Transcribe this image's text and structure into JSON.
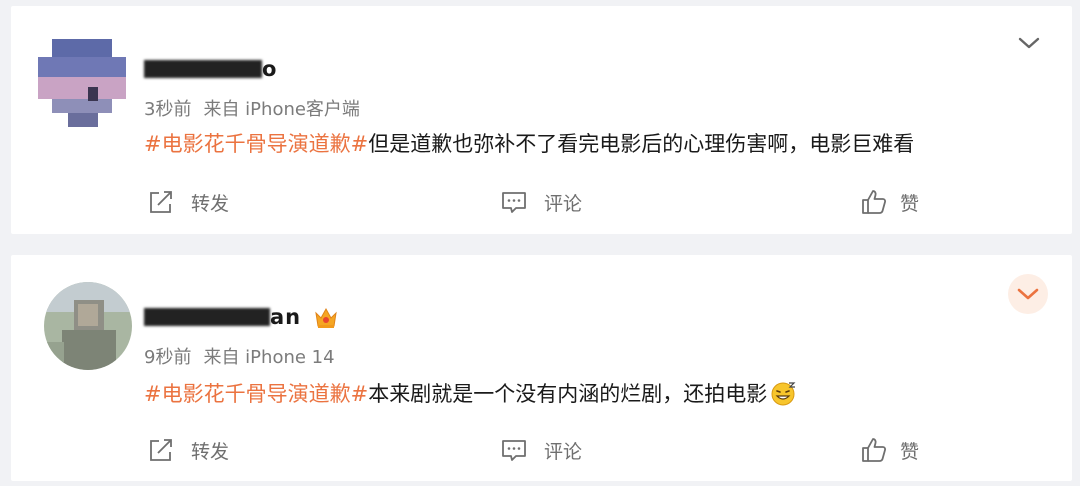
{
  "posts": [
    {
      "user": {
        "name_visible": "o"
      },
      "meta": {
        "time": "3秒前",
        "source": "来自 iPhone客户端"
      },
      "content": {
        "tag": "#电影花千骨导演道歉#",
        "text": "但是道歉也弥补不了看完电影后的心理伤害啊，电影巨难看"
      },
      "actions": {
        "repost": "转发",
        "comment": "评论",
        "like": "赞"
      }
    },
    {
      "user": {
        "name_visible": "an"
      },
      "meta": {
        "time": "9秒前",
        "source": "来自 iPhone 14"
      },
      "content": {
        "tag": "#电影花千骨导演道歉#",
        "text": "本来剧就是一个没有内涵的烂剧，还拍电影"
      },
      "actions": {
        "repost": "转发",
        "comment": "评论",
        "like": "赞"
      }
    }
  ],
  "colors": {
    "accent": "#eb7340",
    "text": "#1a1a1a",
    "meta": "#7b7b7b",
    "icon": "#6f6f6f",
    "background": "#f1f2f5"
  },
  "icons": [
    "chevron-down-icon",
    "repost-icon",
    "comment-icon",
    "like-icon",
    "vip-crown-icon",
    "grinning-emoji-icon"
  ]
}
